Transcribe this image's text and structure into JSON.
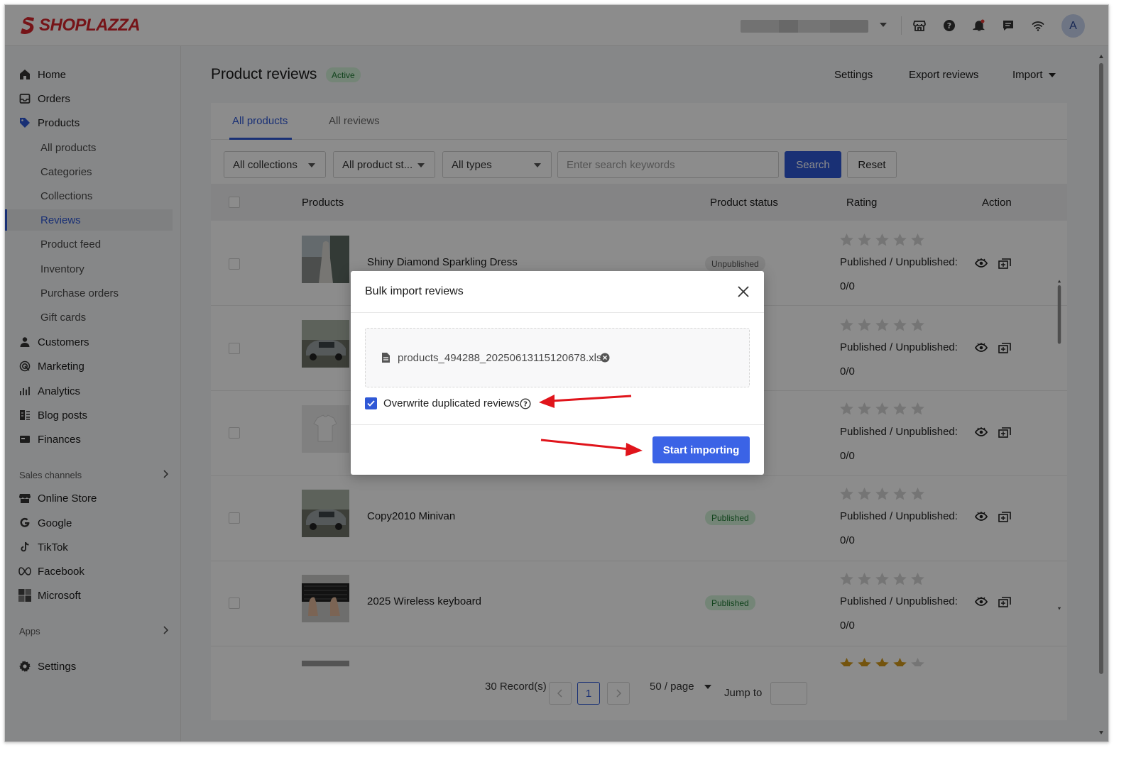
{
  "brand": {
    "name": "SHOPLAZZA",
    "color": "#d8262c",
    "accent": "#2f58d6"
  },
  "topbar": {
    "icons": [
      "store-icon",
      "help-icon",
      "bell-icon",
      "chat-icon",
      "wifi-icon"
    ],
    "avatar_letter": "A"
  },
  "sidebar": {
    "items": [
      {
        "label": "Home",
        "icon": "home-icon"
      },
      {
        "label": "Orders",
        "icon": "orders-icon"
      },
      {
        "label": "Products",
        "icon": "tag-icon"
      },
      {
        "label": "Customers",
        "icon": "person-icon"
      },
      {
        "label": "Marketing",
        "icon": "target-icon"
      },
      {
        "label": "Analytics",
        "icon": "bar-chart-icon"
      },
      {
        "label": "Blog posts",
        "icon": "blog-icon"
      },
      {
        "label": "Finances",
        "icon": "card-icon"
      }
    ],
    "product_subitems": [
      "All products",
      "Categories",
      "Collections",
      "Reviews",
      "Product feed",
      "Inventory",
      "Purchase orders",
      "Gift cards"
    ],
    "active_subitem": "Reviews",
    "sales_channels_label": "Sales channels",
    "channels": [
      {
        "label": "Online Store",
        "icon": "store-icon"
      },
      {
        "label": "Google",
        "icon": "google-icon"
      },
      {
        "label": "TikTok",
        "icon": "tiktok-icon"
      },
      {
        "label": "Facebook",
        "icon": "meta-icon"
      },
      {
        "label": "Microsoft",
        "icon": "microsoft-icon"
      }
    ],
    "apps_label": "Apps",
    "settings_label": "Settings"
  },
  "header": {
    "title": "Product reviews",
    "badge": "Active",
    "settings": "Settings",
    "export": "Export reviews",
    "import": "Import"
  },
  "tabs": [
    "All products",
    "All reviews"
  ],
  "filters": {
    "collections": "All collections",
    "product_status": "All product st...",
    "types": "All types",
    "search_placeholder": "Enter search keywords",
    "search_btn": "Search",
    "reset_btn": "Reset"
  },
  "table": {
    "headers": {
      "products": "Products",
      "status": "Product status",
      "rating": "Rating",
      "action": "Action"
    },
    "rating_label": "Published / Unpublished:",
    "rows": [
      {
        "name": "Shiny Diamond Sparkling Dress",
        "status": "Unpublished",
        "count": "0/0",
        "stars": 0
      },
      {
        "name": "",
        "status": "",
        "count": "0/0",
        "stars": 0
      },
      {
        "name": "",
        "status": "",
        "count": "0/0",
        "stars": 0
      },
      {
        "name": "Copy2010 Minivan",
        "status": "Published",
        "count": "0/0",
        "stars": 0
      },
      {
        "name": "2025 Wireless keyboard",
        "status": "Published",
        "count": "0/0",
        "stars": 0
      },
      {
        "name": "",
        "status": "",
        "count": "",
        "stars": 4
      }
    ]
  },
  "pagination": {
    "records": "30 Record(s)",
    "current": "1",
    "per_page": "50 / page",
    "jump_label": "Jump to"
  },
  "modal": {
    "title": "Bulk import reviews",
    "file_name": "products_494288_20250613115120678.xlsx",
    "checkbox_label": "Overwrite duplicated reviews",
    "checkbox_checked": true,
    "start_btn": "Start importing"
  }
}
